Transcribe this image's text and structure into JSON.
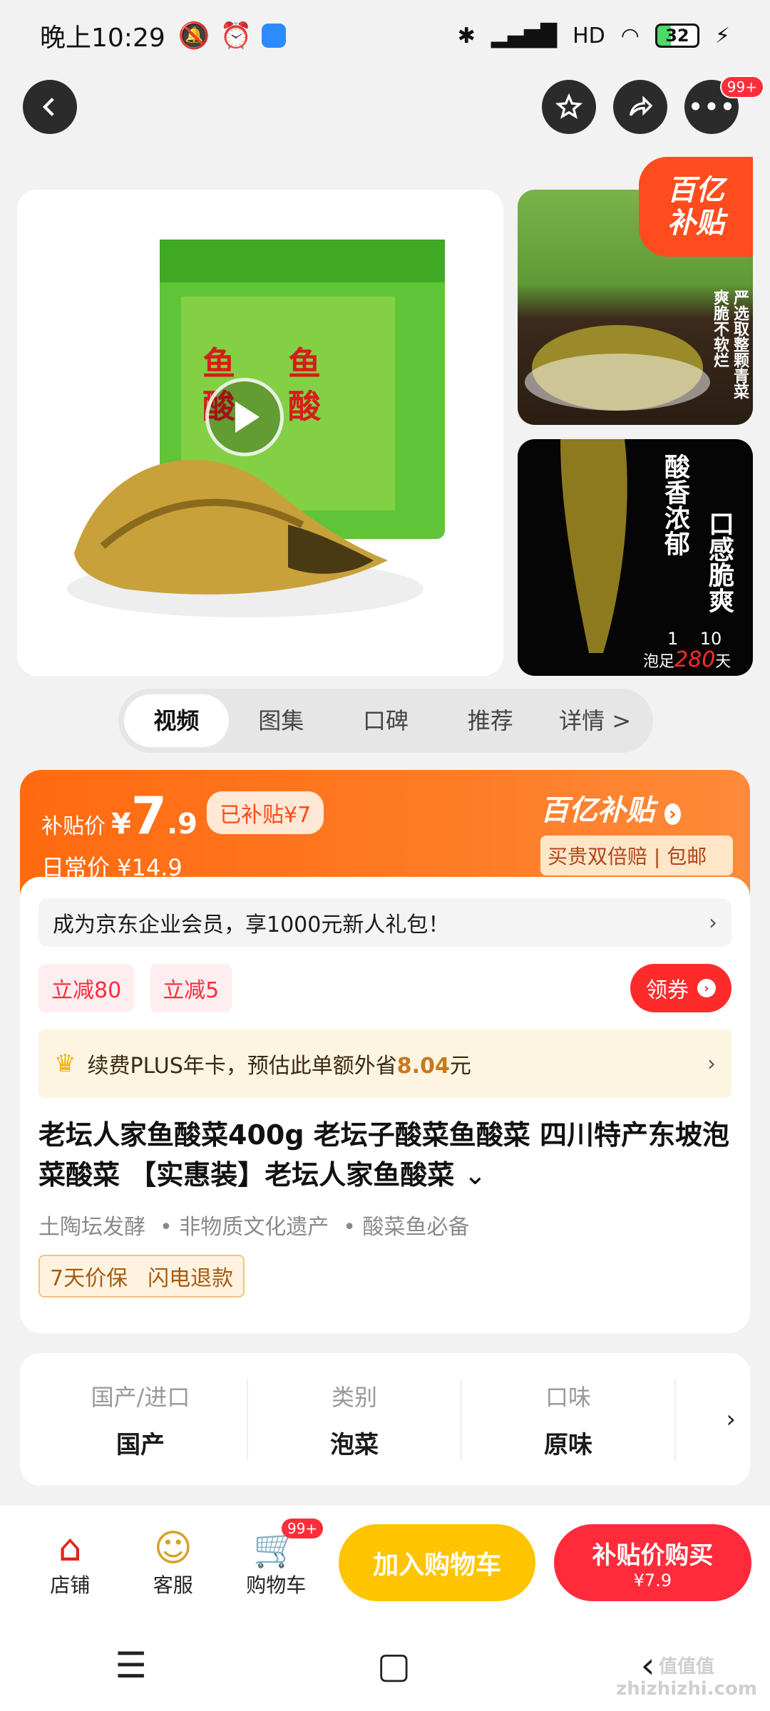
{
  "status_bar": {
    "time": "晚上10:29",
    "signal_hd": "HD",
    "battery": "32"
  },
  "top_nav": {
    "more_badge": "99+"
  },
  "gallery": {
    "badge_line1": "百亿",
    "badge_line2": "补贴",
    "thumb1_text_a": "严选取整颗青菜",
    "thumb1_text_b": "爽脆不软烂",
    "thumb2_text_a": "酸香浓郁",
    "thumb2_text_b": "口感脆爽",
    "thumb2_numbers": "1    10",
    "thumb2_caption_pre": "泡足",
    "thumb2_caption_num": "280",
    "thumb2_caption_post": "天"
  },
  "tabs": [
    "视频",
    "图集",
    "口碑",
    "推荐",
    "详情 >"
  ],
  "price": {
    "label": "补贴价",
    "currency": "¥",
    "integer": "7",
    "decimal": ".9",
    "subsidized_tag": "已补贴¥7",
    "daily_label": "日常价 ¥14.9",
    "logo_text": "百亿补贴",
    "logo_pill": "买贵双倍赔 | 包邮"
  },
  "member_bar": "成为京东企业会员，享1000元新人礼包！",
  "coupons": [
    "立减80",
    "立减5"
  ],
  "get_coupon": "领券",
  "plus_bar": {
    "text_pre": "续费PLUS年卡，预估此单额外省",
    "amount": "8.04",
    "text_post": "元"
  },
  "product_title": "老坛人家鱼酸菜400g 老坛子酸菜鱼酸菜 四川特产东坡泡菜酸菜 【实惠装】老坛人家鱼酸菜",
  "tags": [
    "土陶坛发酵",
    "•  非物质文化遗产",
    "•  酸菜鱼必备"
  ],
  "service_badges": [
    "7天价保",
    "闪电退款"
  ],
  "attributes": [
    {
      "k": "国产/进口",
      "v": "国产"
    },
    {
      "k": "类别",
      "v": "泡菜"
    },
    {
      "k": "口味",
      "v": "原味"
    }
  ],
  "bottom_bar": {
    "shop": "店铺",
    "service": "客服",
    "cart": "购物车",
    "cart_badge": "99+",
    "add_cart": "加入购物车",
    "buy_line1": "补贴价购买",
    "buy_line2": "¥7.9"
  },
  "watermark": "值值值\nzhizhizhi.com",
  "colors": {
    "accent": "#ff6a10",
    "buy": "#ff2b3b",
    "cart": "#ffc400"
  }
}
